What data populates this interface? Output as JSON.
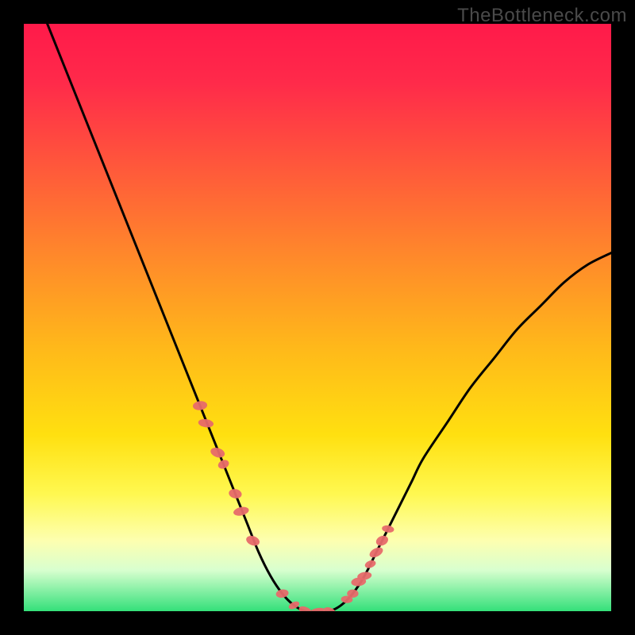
{
  "watermark": "TheBottleneck.com",
  "colors": {
    "background": "#000000",
    "curve": "#000000",
    "marker": "#e76a6a",
    "gradient_stops": [
      "#ff1a4a",
      "#ff2a4a",
      "#ff5a3a",
      "#ff8a2a",
      "#ffb81a",
      "#ffe010",
      "#fff850",
      "#fdffb0",
      "#d8ffcf",
      "#34e07a"
    ]
  },
  "chart_data": {
    "type": "line",
    "title": "",
    "xlabel": "",
    "ylabel": "",
    "xlim": [
      0,
      100
    ],
    "ylim": [
      0,
      100
    ],
    "series": [
      {
        "name": "bottleneck-curve",
        "x": [
          4,
          6,
          8,
          10,
          12,
          14,
          16,
          18,
          20,
          22,
          24,
          26,
          28,
          30,
          32,
          34,
          36,
          38,
          40,
          42,
          44,
          46,
          48,
          50,
          52,
          54,
          56,
          58,
          60,
          62,
          64,
          66,
          68,
          72,
          76,
          80,
          84,
          88,
          92,
          96,
          100
        ],
        "y": [
          100,
          95,
          90,
          85,
          80,
          75,
          70,
          65,
          60,
          55,
          50,
          45,
          40,
          35,
          30,
          25,
          20,
          15,
          10,
          6,
          3,
          1,
          0,
          0,
          0,
          1,
          3,
          6,
          10,
          14,
          18,
          22,
          26,
          32,
          38,
          43,
          48,
          52,
          56,
          59,
          61
        ]
      }
    ],
    "markers": {
      "name": "highlighted-points",
      "x": [
        30,
        31,
        33,
        34,
        36,
        37,
        39,
        44,
        46,
        48,
        50,
        52,
        55,
        56,
        57,
        58,
        59,
        60,
        61,
        62
      ],
      "y": [
        35,
        32,
        27,
        25,
        20,
        17,
        12,
        3,
        1,
        0,
        0,
        0,
        2,
        3,
        5,
        6,
        8,
        10,
        12,
        14
      ]
    }
  }
}
